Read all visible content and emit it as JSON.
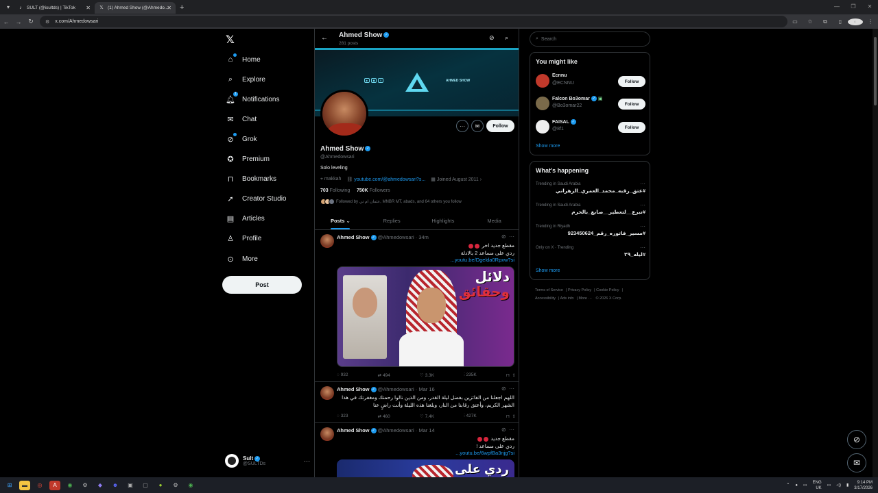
{
  "browser": {
    "tabs": [
      {
        "title": "SULT (@isultds) | TikTok",
        "icon": "tiktok-icon",
        "active": false
      },
      {
        "title": "(1) Ahmed Show (@Ahmedo...",
        "icon": "x-icon",
        "active": true
      }
    ],
    "url": "x.com/Ahmedowsari"
  },
  "nav": {
    "items": [
      {
        "label": "Home",
        "icon": "home-icon"
      },
      {
        "label": "Explore",
        "icon": "search-icon"
      },
      {
        "label": "Notifications",
        "icon": "bell-icon"
      },
      {
        "label": "Chat",
        "icon": "mail-icon"
      },
      {
        "label": "Grok",
        "icon": "grok-icon"
      },
      {
        "label": "Premium",
        "icon": "premium-icon"
      },
      {
        "label": "Bookmarks",
        "icon": "bookmark-icon"
      },
      {
        "label": "Creator Studio",
        "icon": "rocket-icon"
      },
      {
        "label": "Articles",
        "icon": "article-icon"
      },
      {
        "label": "Profile",
        "icon": "person-icon"
      },
      {
        "label": "More",
        "icon": "more-circle-icon"
      }
    ],
    "post_label": "Post",
    "me": {
      "name": "Sult",
      "handle": "@SULTDs"
    }
  },
  "profile": {
    "header_name": "Ahmed Show",
    "posts_count": "281 posts",
    "banner_text": "AHMED SHOW",
    "name": "Ahmed Show",
    "handle": "@Ahmedowsari",
    "bio": "Solo leveling",
    "location": "makkah",
    "link": "youtube.com/@ahmedowsari?s...",
    "joined": "Joined August 2011",
    "following_count": "703",
    "following_label": "Following",
    "followers_count": "750K",
    "followers_label": "Followers",
    "followed_by": "Followed by عثمان ام تي, MNBR MT, abads, and 64 others you follow",
    "follow_label": "Follow",
    "tabs": [
      "Posts",
      "Replies",
      "Highlights",
      "Media"
    ]
  },
  "tweets": [
    {
      "name": "Ahmed Show",
      "handle": "@Ahmedowsari · 34m",
      "line1": "مقطع جديد اخر",
      "line2": "ردي على مساعد 2 بالادلة",
      "link": "youtu.be/Dgelda0Rpxw?si...",
      "media_title_1": "دلائل",
      "media_title_2": "وحقائق",
      "replies": "932",
      "reposts": "494",
      "likes": "3.3K",
      "views": "235K"
    },
    {
      "name": "Ahmed Show",
      "handle": "@Ahmedowsari · Mar 16",
      "text": "اللهم اجعلنا من الفائزين بفضل ليلة القدر، ومن الذين نالوا رحمتك ومغفرتك في هذا الشهر الكريم، وأعتق رقابنا من النار، وبلغنا هذه الليلة وأنت راضٍ عنا",
      "replies": "323",
      "reposts": "460",
      "likes": "7.4K",
      "views": "427K"
    },
    {
      "name": "Ahmed Show",
      "handle": "@Ahmedowsari · Mar 14",
      "line1": "مقطع جديد",
      "line2": "ردي على مساعد !",
      "link": "youtu.be/6wpfBa3njg?si...",
      "media_title": "ردي على"
    }
  ],
  "right": {
    "search_placeholder": "Search",
    "wtf_title": "You might like",
    "wtf": [
      {
        "name": "Ecnnu",
        "handle": "@ECNNU",
        "color": "#c0392b"
      },
      {
        "name": "Falcon Bo3omar",
        "handle": "@Bo3omar22",
        "color": "#7a6a4a"
      },
      {
        "name": "FAISAL",
        "handle": "@8f1",
        "color": "#eeeeee"
      }
    ],
    "follow_label": "Follow",
    "show_more": "Show more",
    "happening_title": "What’s happening",
    "trends": [
      {
        "context": "Trending in Saudi Arabia",
        "title": "#عتق_رقبه_محمد_العمري_الزهراني"
      },
      {
        "context": "Trending in Saudi Arabia",
        "title": "#تبرع__لتعطير__صابغ_بالحرم"
      },
      {
        "context": "Trending in Riyadh",
        "title": "#مسير_فاتوره_رقم_9﻿234﻿5062﻿4"
      },
      {
        "context": "Only on X · Trending",
        "title": "#ليله_٢٩"
      }
    ],
    "footer": [
      "Terms of Service",
      "Privacy Policy",
      "Cookie Policy",
      "Accessibility",
      "Ads info",
      "More ···",
      "© 2026 X Corp."
    ]
  },
  "taskbar": {
    "lang": "ENG",
    "region": "UK",
    "time": "9:14 PM",
    "date": "3/17/2026"
  }
}
